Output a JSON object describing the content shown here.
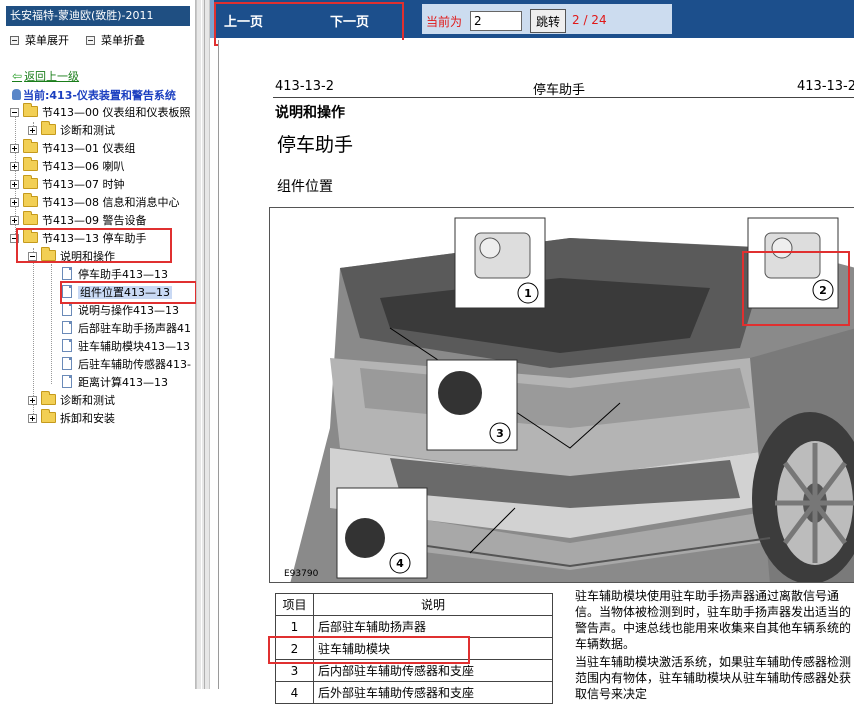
{
  "app": {
    "title": "长安福特-蒙迪欧(致胜)-2011"
  },
  "tree_menu": {
    "expand_label": "菜单展开",
    "collapse_label": "菜单折叠"
  },
  "nav": {
    "back_label": "返回上一级",
    "current_label": "当前:413-仪表装置和警告系统"
  },
  "tree": {
    "n1": "节413—00 仪表组和仪表板照",
    "n1a": "诊断和测试",
    "n2": "节413—01 仪表组",
    "n3": "节413—06 喇叭",
    "n4": "节413—07 时钟",
    "n5": "节413—08 信息和消息中心",
    "n6": "节413—09 警告设备",
    "n7": "节413—13 停车助手",
    "n7a": "说明和操作",
    "d1": "停车助手413—13",
    "d2": "组件位置413—13",
    "d3": "说明与操作413—13",
    "d4": "后部驻车助手扬声器41",
    "d5": "驻车辅助模块413—13",
    "d6": "后驻车辅助传感器413-",
    "d7": "距离计算413—13",
    "n7b": "诊断和测试",
    "n7c": "拆卸和安装"
  },
  "toolbar": {
    "prev_label": "上一页",
    "next_label": "下一页",
    "page_label": "当前为",
    "page_value": "2",
    "jump_label": "跳转",
    "page_count": "2 / 24"
  },
  "document": {
    "header_left": "413-13-2",
    "header_center": "停车助手",
    "header_right": "413-13-2",
    "section_title": "说明和操作",
    "page_title": "停车助手",
    "subheading": "组件位置",
    "figure_code": "E93790",
    "callouts": [
      "1",
      "2",
      "3",
      "4"
    ],
    "table": {
      "col_item": "项目",
      "col_desc": "说明",
      "rows": [
        {
          "item": "1",
          "desc": "后部驻车辅助扬声器"
        },
        {
          "item": "2",
          "desc": "驻车辅助模块"
        },
        {
          "item": "3",
          "desc": "后内部驻车辅助传感器和支座"
        },
        {
          "item": "4",
          "desc": "后外部驻车辅助传感器和支座"
        }
      ]
    },
    "para1": "驻车辅助模块使用驻车助手扬声器通过离散信号通信。当物体被检测到时，驻车助手扬声器发出适当的警告声。中速总线也能用来收集来自其他车辆系统的车辆数据。",
    "para2": "当驻车辅助模块激活系统，如果驻车辅助传感器检测范围内有物体，驻车辅助模块从驻车辅助传感器处获取信号来决定"
  },
  "colors": {
    "toolbar_bg": "#1c4f8c",
    "highlight": "#e03030",
    "page_red": "#e01818"
  }
}
